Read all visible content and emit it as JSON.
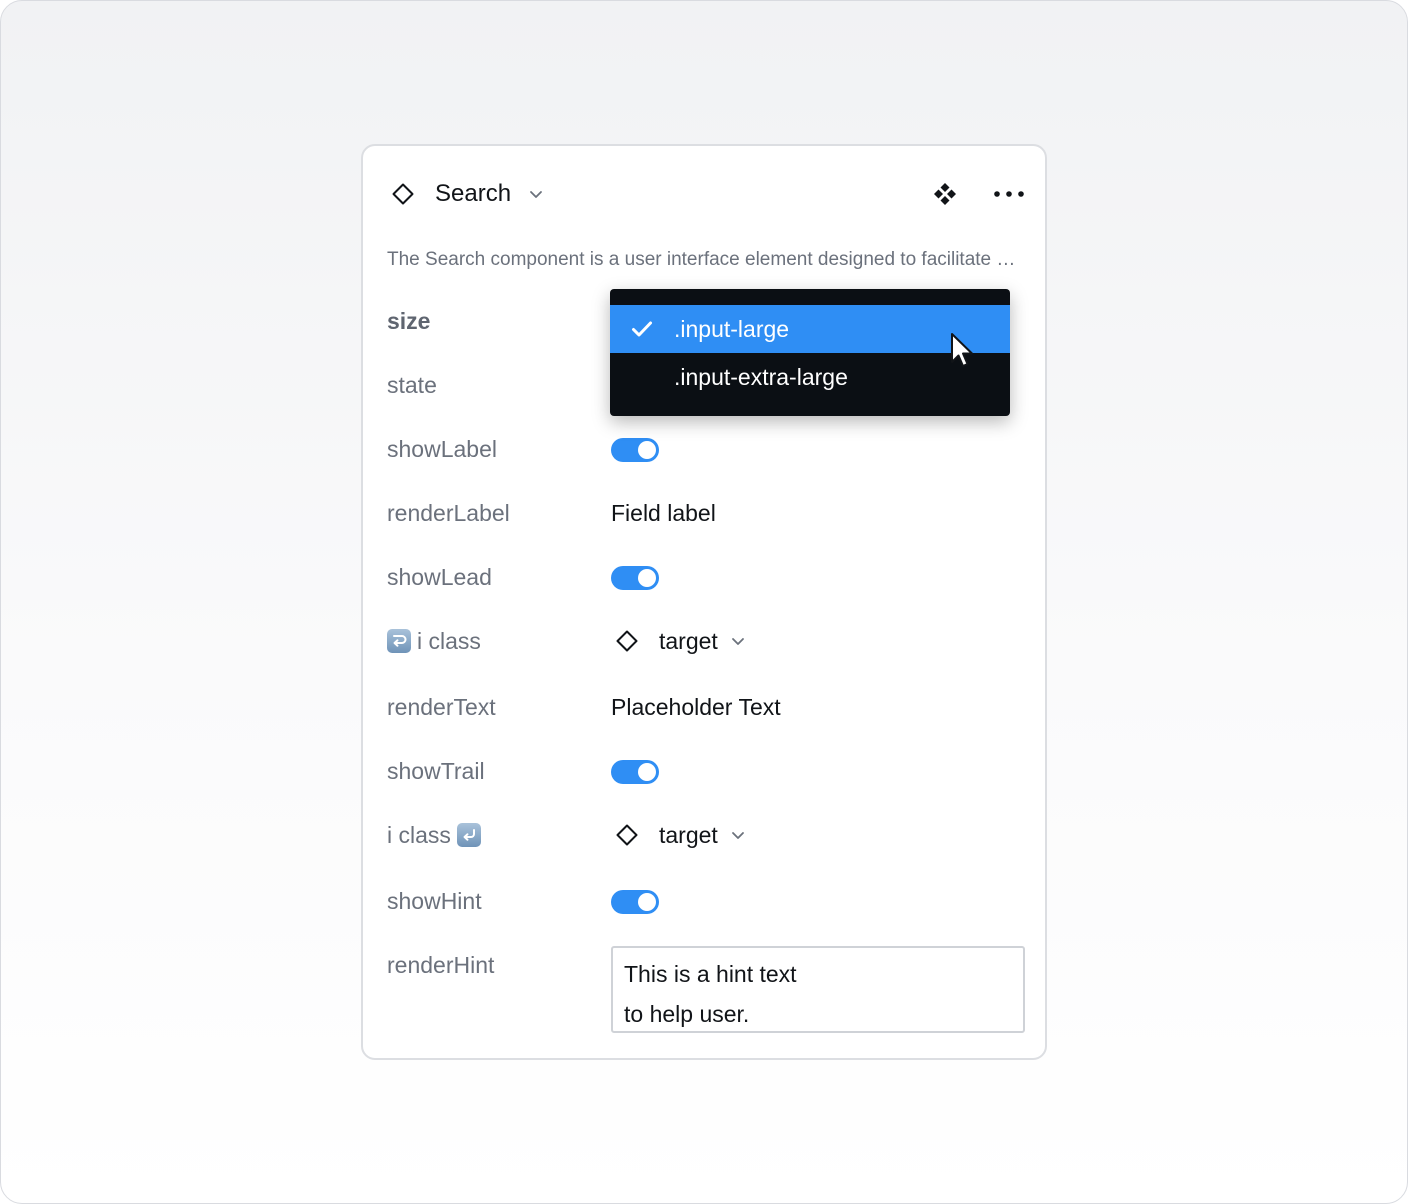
{
  "header": {
    "title": "Search",
    "description": "The Search component is a user interface element designed to facilitate searching"
  },
  "props": {
    "size_label": "size",
    "state_label": "state",
    "show_label_label": "showLabel",
    "render_label_label": "renderLabel",
    "render_label_value": "Field label",
    "show_lead_label": "showLead",
    "lead_icon_label": "i class",
    "lead_icon_value": "target",
    "render_text_label": "renderText",
    "render_text_value": "Placeholder Text",
    "show_trail_label": "showTrail",
    "trail_icon_label": "i class",
    "trail_icon_value": "target",
    "show_hint_label": "showHint",
    "render_hint_label": "renderHint",
    "render_hint_line1": "This is a hint text",
    "render_hint_line2": "to help user."
  },
  "dropdown": {
    "options": [
      {
        "label": ".input-large",
        "selected": true
      },
      {
        "label": ".input-extra-large",
        "selected": false
      }
    ]
  },
  "colors": {
    "accent": "#2f8ef4",
    "dropdown_bg": "#0b0f14",
    "label_text": "#6b717c"
  },
  "icons": {
    "component": "diamond-outline-icon",
    "component_set": "component-set-icon",
    "more": "more-horizontal-icon",
    "chevron": "chevron-down-icon",
    "check": "check-icon",
    "lead": "arrow-right-hook-icon",
    "trail": "arrow-left-hook-icon"
  }
}
